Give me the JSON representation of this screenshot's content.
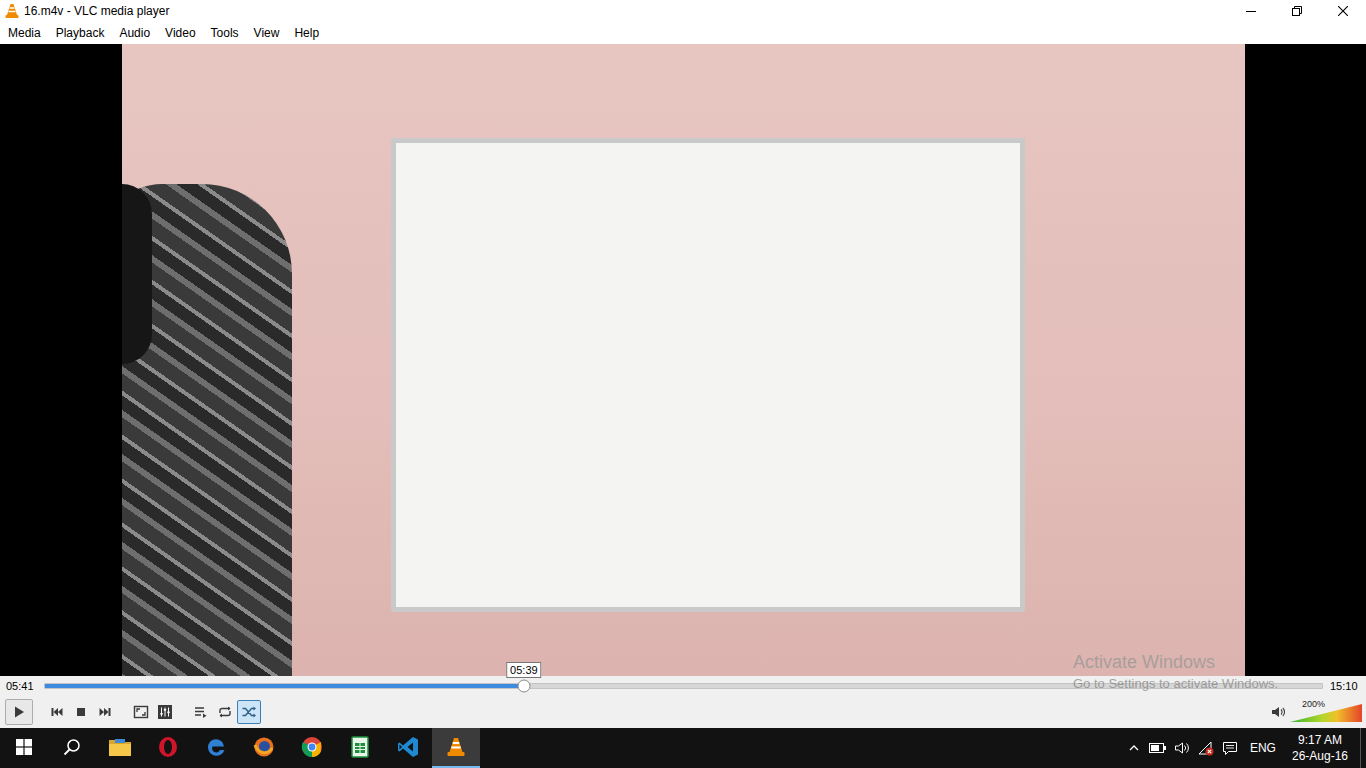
{
  "window": {
    "title": "16.m4v - VLC media player"
  },
  "menu": [
    "Media",
    "Playback",
    "Audio",
    "Video",
    "Tools",
    "View",
    "Help"
  ],
  "seek": {
    "elapsed": "05:41",
    "total": "15:10",
    "level": 0.375,
    "tooltip": "05:39"
  },
  "controls": [
    {
      "kind": "play",
      "selected": false
    },
    {
      "kind": "previous",
      "selected": false
    },
    {
      "kind": "stop",
      "selected": false
    },
    {
      "kind": "next",
      "selected": false
    },
    {
      "kind": "fullscreen",
      "selected": false
    },
    {
      "kind": "extended",
      "selected": false
    },
    {
      "kind": "playlist",
      "selected": false
    },
    {
      "kind": "loop",
      "selected": false
    },
    {
      "kind": "random",
      "selected": true
    }
  ],
  "volume": {
    "reading": "200%",
    "level": 1.0
  },
  "watermark": {
    "title": "Activate Windows",
    "subtitle": "Go to Settings to activate Windows."
  },
  "taskbar": {
    "apps": [
      {
        "kind": "explorer",
        "selected": false
      },
      {
        "kind": "opera",
        "selected": false
      },
      {
        "kind": "edge",
        "selected": false
      },
      {
        "kind": "firefox",
        "selected": false
      },
      {
        "kind": "chrome",
        "selected": false
      },
      {
        "kind": "sheets",
        "selected": false
      },
      {
        "kind": "vscode",
        "selected": false
      },
      {
        "kind": "vlc",
        "selected": true
      }
    ],
    "language": "ENG",
    "time": "9:17 AM",
    "date": "26-Aug-16"
  }
}
